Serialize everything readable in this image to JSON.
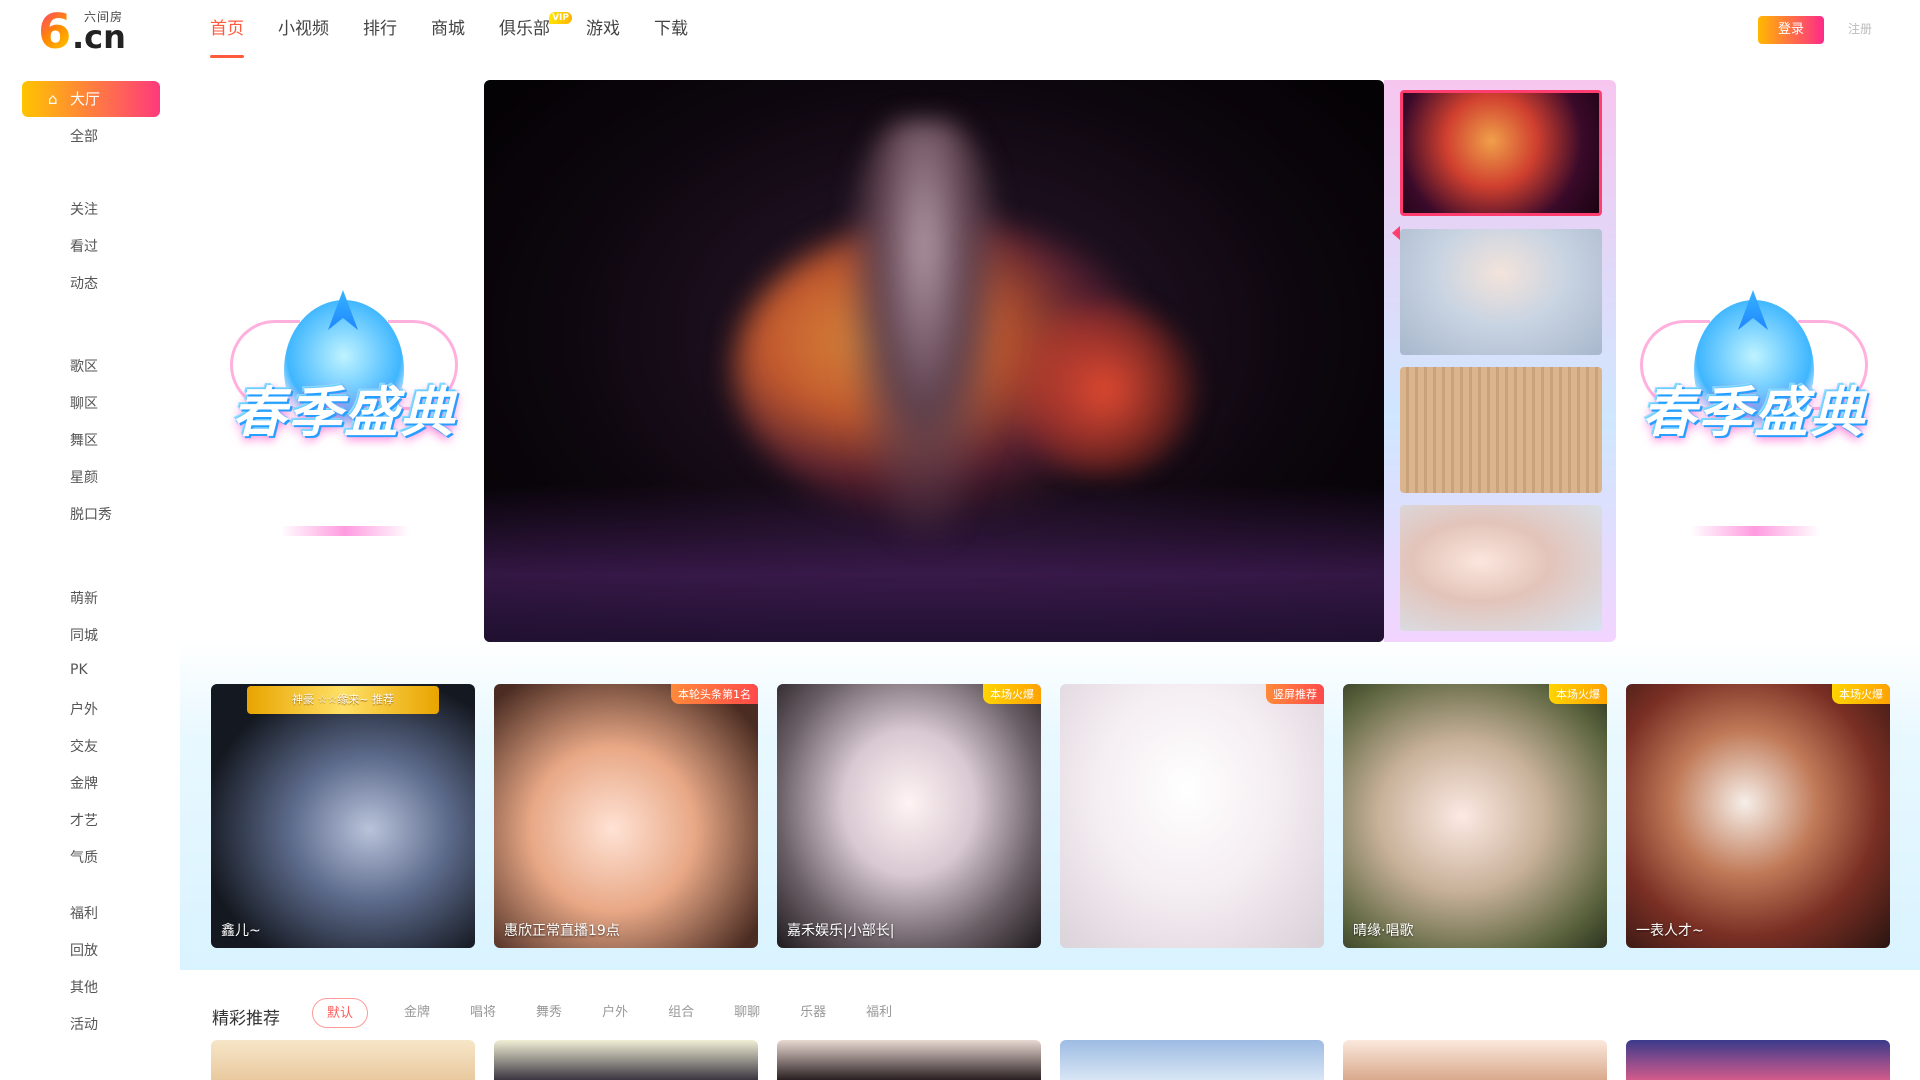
{
  "brand": {
    "logo_cn": ".cn",
    "logo_sub": "六间房"
  },
  "nav": [
    {
      "label": "首页",
      "active": true
    },
    {
      "label": "小视频"
    },
    {
      "label": "排行"
    },
    {
      "label": "商城"
    },
    {
      "label": "俱乐部",
      "badge": "VIP"
    },
    {
      "label": "游戏"
    },
    {
      "label": "下载"
    }
  ],
  "auth": {
    "login": "登录",
    "register": "注册"
  },
  "sidebar": {
    "hall": "大厅",
    "items": [
      "全部",
      "关注",
      "看过",
      "动态",
      "歌区",
      "聊区",
      "舞区",
      "星颜",
      "脱口秀",
      "萌新",
      "同城",
      "PK",
      "户外",
      "交友",
      "金牌",
      "才艺",
      "气质",
      "福利",
      "回放",
      "其他",
      "活动"
    ]
  },
  "banner": {
    "title": "春季盛典"
  },
  "cards": [
    {
      "name": "鑫儿~",
      "crown": "神豪 ☆☆缘来~ 推荐"
    },
    {
      "name": "惠欣正常直播19点",
      "tag": "本轮头条第1名"
    },
    {
      "name": "嘉禾娱乐|小部长|",
      "tag": "本场火爆",
      "tag_style": "gold"
    },
    {
      "name": "",
      "tag": "竖屏推荐"
    },
    {
      "name": "晴缘·唱歌",
      "tag": "本场火爆",
      "tag_style": "gold"
    },
    {
      "name": "一表人才~",
      "tag": "本场火爆",
      "tag_style": "gold"
    }
  ],
  "recommend": {
    "title": "精彩推荐",
    "tabs": [
      "默认",
      "金牌",
      "唱将",
      "舞秀",
      "户外",
      "组合",
      "聊聊",
      "乐器",
      "福利"
    ]
  },
  "colors": {
    "accent": "#ff5a3c",
    "login_gradient": [
      "#ffb800",
      "#ff2a8a"
    ]
  }
}
